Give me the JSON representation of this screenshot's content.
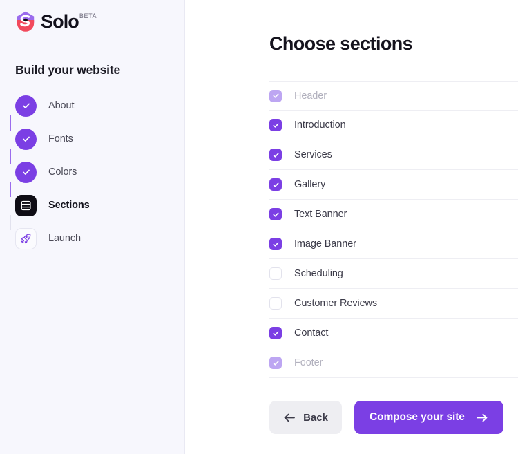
{
  "brand": {
    "name": "Solo",
    "badge": "BETA",
    "logo_icon": "solo-hexagon-logo",
    "logo_colors": {
      "top": "#9b6ced",
      "bottom": "#f2495c"
    }
  },
  "colors": {
    "accent": "#7b3fe4",
    "accent_muted": "#bda6f2",
    "sidebar_bg": "#f7f7fd",
    "active_step_bg": "#0f0d15",
    "divider": "#eeeef3"
  },
  "sidebar": {
    "title": "Build your website",
    "steps": [
      {
        "label": "About",
        "state": "done",
        "icon": "check-icon"
      },
      {
        "label": "Fonts",
        "state": "done",
        "icon": "check-icon"
      },
      {
        "label": "Colors",
        "state": "done",
        "icon": "check-icon"
      },
      {
        "label": "Sections",
        "state": "active",
        "icon": "layout-sections-icon"
      },
      {
        "label": "Launch",
        "state": "todo",
        "icon": "rocket-icon"
      }
    ]
  },
  "main": {
    "heading": "Choose sections",
    "sections": [
      {
        "label": "Header",
        "state": "disabled"
      },
      {
        "label": "Introduction",
        "state": "checked"
      },
      {
        "label": "Services",
        "state": "checked"
      },
      {
        "label": "Gallery",
        "state": "checked"
      },
      {
        "label": "Text Banner",
        "state": "checked"
      },
      {
        "label": "Image Banner",
        "state": "checked"
      },
      {
        "label": "Scheduling",
        "state": "unchecked"
      },
      {
        "label": "Customer Reviews",
        "state": "unchecked"
      },
      {
        "label": "Contact",
        "state": "checked"
      },
      {
        "label": "Footer",
        "state": "disabled"
      }
    ],
    "actions": {
      "back_label": "Back",
      "back_icon": "arrow-left-icon",
      "compose_label": "Compose your site",
      "compose_icon": "arrow-right-icon"
    }
  }
}
